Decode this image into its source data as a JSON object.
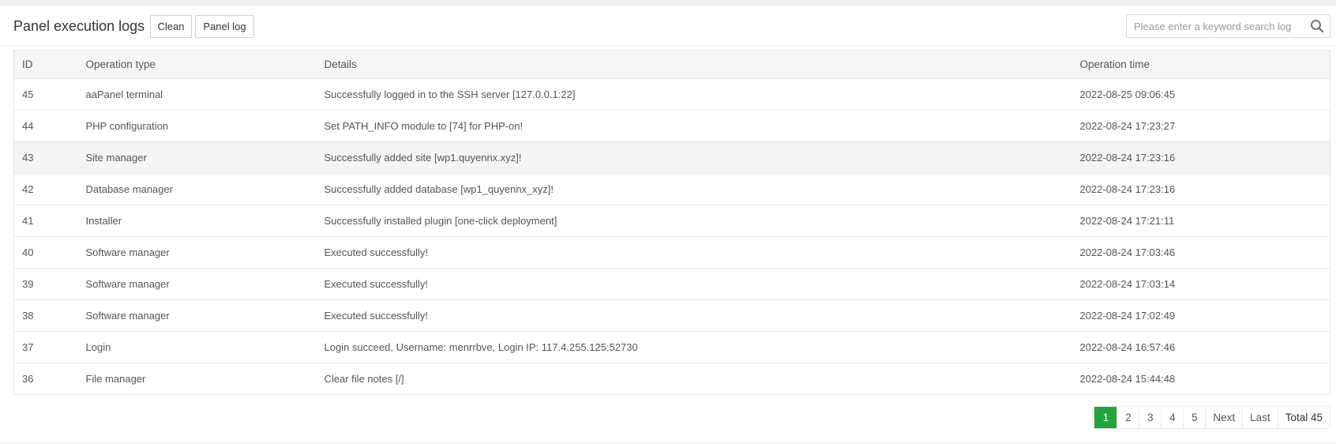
{
  "header": {
    "title": "Panel execution logs",
    "clean_label": "Clean",
    "panel_log_label": "Panel log",
    "search_placeholder": "Please enter a keyword search log"
  },
  "table": {
    "columns": [
      "ID",
      "Operation type",
      "Details",
      "Operation time"
    ],
    "rows": [
      {
        "id": "45",
        "type": "aaPanel terminal",
        "details": "Successfully logged in to the SSH server [127.0.0.1:22]",
        "time": "2022-08-25 09:06:45"
      },
      {
        "id": "44",
        "type": "PHP configuration",
        "details": "Set PATH_INFO module to [74] for PHP-on!",
        "time": "2022-08-24 17:23:27"
      },
      {
        "id": "43",
        "type": "Site manager",
        "details": "Successfully added site [wp1.quyennx.xyz]!",
        "time": "2022-08-24 17:23:16"
      },
      {
        "id": "42",
        "type": "Database manager",
        "details": "Successfully added database [wp1_quyennx_xyz]!",
        "time": "2022-08-24 17:23:16"
      },
      {
        "id": "41",
        "type": "Installer",
        "details": "Successfully installed plugin [one-click deployment]",
        "time": "2022-08-24 17:21:11"
      },
      {
        "id": "40",
        "type": "Software manager",
        "details": "Executed successfully!",
        "time": "2022-08-24 17:03:46"
      },
      {
        "id": "39",
        "type": "Software manager",
        "details": "Executed successfully!",
        "time": "2022-08-24 17:03:14"
      },
      {
        "id": "38",
        "type": "Software manager",
        "details": "Executed successfully!",
        "time": "2022-08-24 17:02:49"
      },
      {
        "id": "37",
        "type": "Login",
        "details": "Login succeed, Username: menrrbve, Login IP: 117.4.255.125:52730",
        "time": "2022-08-24 16:57:46"
      },
      {
        "id": "36",
        "type": "File manager",
        "details": "Clear file notes [/]",
        "time": "2022-08-24 15:44:48"
      }
    ]
  },
  "pagination": {
    "pages": [
      "1",
      "2",
      "3",
      "4",
      "5"
    ],
    "current": "1",
    "next_label": "Next",
    "last_label": "Last",
    "total_label": "Total 45"
  },
  "colors": {
    "accent": "#20a53a",
    "hover_row": "#f4f4f4"
  }
}
